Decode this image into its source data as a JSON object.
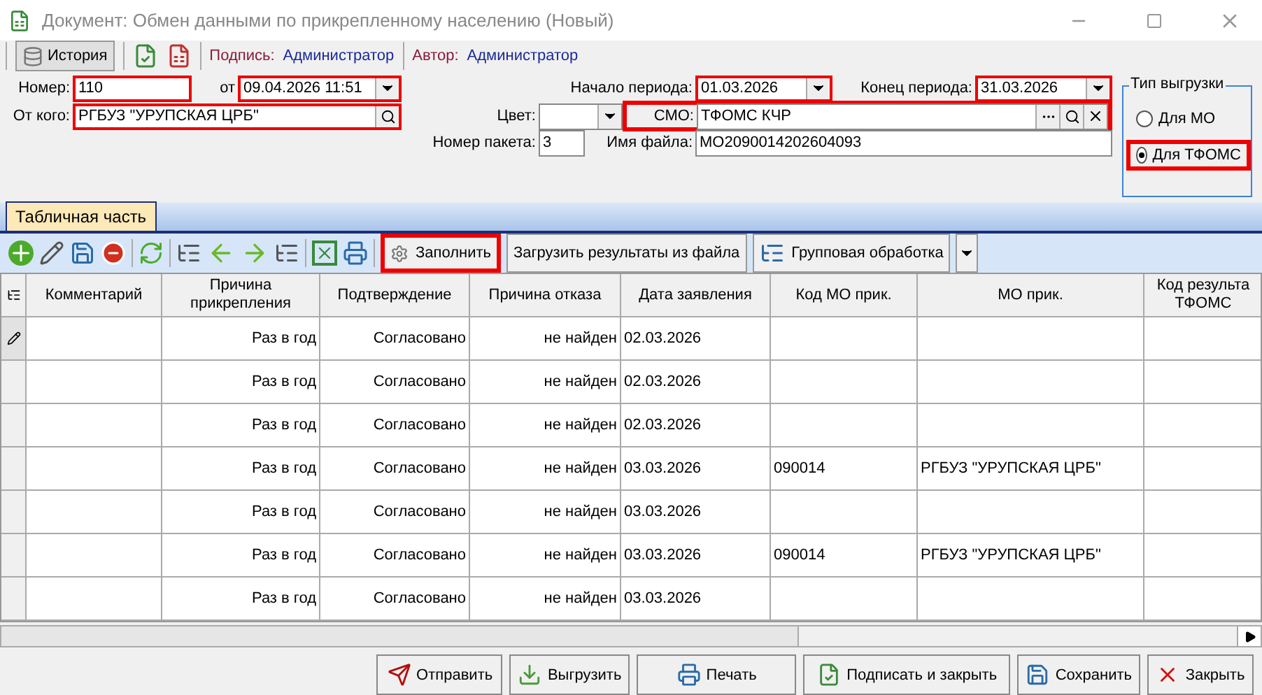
{
  "window": {
    "title": "Документ: Обмен данными по прикрепленному населению (Новый)"
  },
  "toolbar": {
    "history_button": "История",
    "signature_label": "Подпись:",
    "signature_value": "Администратор",
    "author_label": "Автор:",
    "author_value": "Администратор"
  },
  "form": {
    "number": {
      "label": "Номер:",
      "value": "110",
      "highlighted": true
    },
    "date": {
      "label": "от",
      "value": "09.04.2026 11:51",
      "highlighted": true
    },
    "from": {
      "label": "От кого:",
      "value": "РГБУЗ \"УРУПСКАЯ ЦРБ\"",
      "highlighted": true
    },
    "period_start": {
      "label": "Начало периода:",
      "value": "01.03.2026",
      "highlighted": true
    },
    "period_end": {
      "label": "Конец периода:",
      "value": "31.03.2026",
      "highlighted": true
    },
    "color": {
      "label": "Цвет:"
    },
    "smo": {
      "label": "СМО:",
      "value": "ТФОМС КЧР",
      "highlighted": true
    },
    "packet_number": {
      "label": "Номер пакета:",
      "value": "3"
    },
    "file_name": {
      "label": "Имя файла:",
      "value": "MO2090014202604093"
    }
  },
  "export_type": {
    "title": "Тип выгрузки",
    "options": [
      {
        "label": "Для МО",
        "selected": false,
        "highlighted": false
      },
      {
        "label": "Для ТФОМС",
        "selected": true,
        "highlighted": true
      }
    ]
  },
  "tabs": [
    {
      "label": "Табличная часть",
      "selected": true
    }
  ],
  "grid_toolbar": {
    "fill_button": {
      "label": "Заполнить",
      "highlighted": true
    },
    "load_button": "Загрузить результаты из файла",
    "group_button": "Групповая обработка"
  },
  "table": {
    "columns": [
      {
        "label": "Комментарий"
      },
      {
        "label": "Причина прикрепления"
      },
      {
        "label": "Подтверждение"
      },
      {
        "label": "Причина отказа"
      },
      {
        "label": "Дата заявления"
      },
      {
        "label": "Код МО прик."
      },
      {
        "label": "МО прик."
      },
      {
        "label": "Код результа ТФОМС"
      }
    ],
    "rows": [
      {
        "current": true,
        "reason": "Раз в год",
        "confirm": "Согласовано",
        "refusal": "не найден",
        "date": "02.03.2026"
      },
      {
        "current": false,
        "reason": "Раз в год",
        "confirm": "Согласовано",
        "refusal": "не найден",
        "date": "02.03.2026"
      },
      {
        "current": false,
        "reason": "Раз в год",
        "confirm": "Согласовано",
        "refusal": "не найден",
        "date": "02.03.2026"
      },
      {
        "current": false,
        "reason": "Раз в год",
        "confirm": "Согласовано",
        "refusal": "не найден",
        "date": "03.03.2026",
        "mo_code": "090014",
        "mo": "РГБУЗ \"УРУПСКАЯ ЦРБ\""
      },
      {
        "current": false,
        "reason": "Раз в год",
        "confirm": "Согласовано",
        "refusal": "не найден",
        "date": "03.03.2026"
      },
      {
        "current": false,
        "reason": "Раз в год",
        "confirm": "Согласовано",
        "refusal": "не найден",
        "date": "03.03.2026",
        "mo_code": "090014",
        "mo": "РГБУЗ \"УРУПСКАЯ ЦРБ\""
      },
      {
        "current": false,
        "reason": "Раз в год",
        "confirm": "Согласовано",
        "refusal": "не найден",
        "date": "03.03.2026"
      }
    ]
  },
  "buttons": [
    {
      "kind": "send",
      "label": "Отправить"
    },
    {
      "kind": "export",
      "label": "Выгрузить"
    },
    {
      "kind": "print",
      "label": "Печать"
    },
    {
      "kind": "sign",
      "label": "Подписать и закрыть"
    },
    {
      "kind": "save",
      "label": "Сохранить"
    },
    {
      "kind": "close",
      "label": "Закрыть"
    }
  ]
}
